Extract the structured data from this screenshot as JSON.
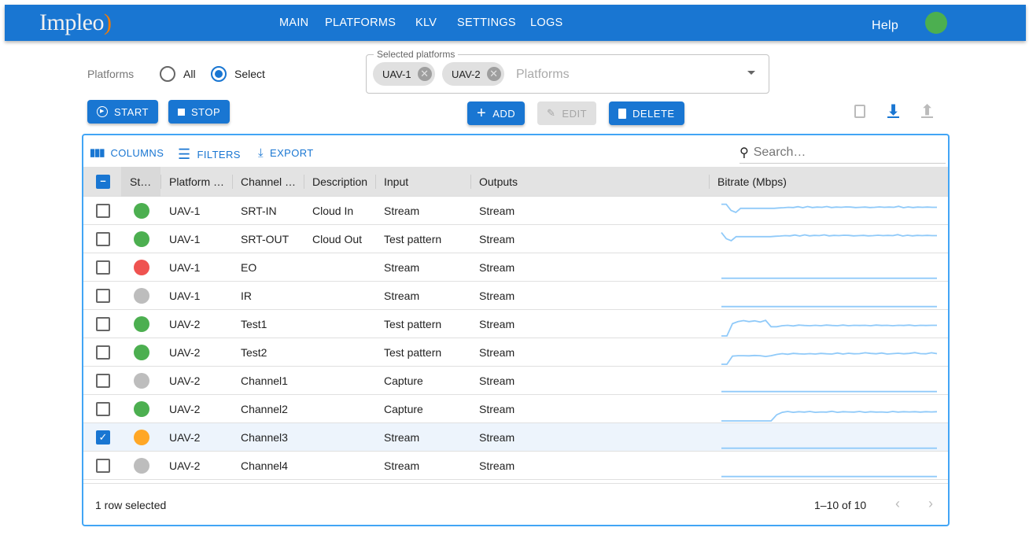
{
  "colors": {
    "primary": "#1976d2",
    "green": "#4caf50",
    "red": "#ef5350",
    "grey": "#bdbdbd",
    "orange": "#ffa726",
    "sparkline": "#90caf9"
  },
  "nav": {
    "logo": "Impleo",
    "items": [
      "MAIN",
      "PLATFORMS",
      "KLV",
      "SETTINGS",
      "LOGS"
    ],
    "help": "Help"
  },
  "filter": {
    "label": "Platforms",
    "options": [
      "All",
      "Select"
    ],
    "selected": "Select",
    "legend": "Selected platforms",
    "chips": [
      "UAV-1",
      "UAV-2"
    ],
    "placeholder": "Platforms"
  },
  "actions": {
    "start": "START",
    "stop": "STOP",
    "add": "ADD",
    "edit": "EDIT",
    "delete": "DELETE"
  },
  "toolbar": {
    "columns": "COLUMNS",
    "filters": "FILTERS",
    "export": "EXPORT",
    "search_placeholder": "Search…"
  },
  "columns": [
    "St…",
    "Platform …",
    "Channel …",
    "Description",
    "Input",
    "Outputs",
    "Bitrate (Mbps)"
  ],
  "rows": [
    {
      "status": "green",
      "platform": "UAV-1",
      "channel": "SRT-IN",
      "description": "Cloud In",
      "input": "Stream",
      "outputs": "Stream",
      "checked": false,
      "bitrate": [
        9,
        9,
        6,
        5,
        7,
        7,
        7,
        7,
        7,
        7,
        7,
        7,
        7.2,
        7.3,
        7.5,
        7.4,
        7.8,
        7.3,
        7.9,
        7.4,
        7.6,
        7.5,
        7.9,
        7.4,
        7.6,
        7.5,
        7.7,
        7.6,
        7.4,
        7.5,
        7.6,
        7.4,
        7.5,
        7.7,
        7.5,
        7.6,
        7.5,
        8,
        7.3,
        7.7,
        7.4,
        7.6,
        7.5,
        7.6,
        7.5,
        7.5
      ]
    },
    {
      "status": "green",
      "platform": "UAV-1",
      "channel": "SRT-OUT",
      "description": "Cloud Out",
      "input": "Test pattern",
      "outputs": "Stream",
      "checked": false,
      "bitrate": [
        9,
        6,
        5,
        7,
        7,
        7,
        7,
        7,
        7,
        7,
        7,
        7.2,
        7.3,
        7.5,
        7.4,
        7.8,
        7.3,
        7.9,
        7.4,
        7.6,
        7.5,
        7.9,
        7.4,
        7.6,
        7.5,
        7.7,
        7.6,
        7.4,
        7.5,
        7.6,
        7.4,
        7.5,
        7.7,
        7.5,
        7.6,
        7.5,
        8,
        7.3,
        7.7,
        7.4,
        7.6,
        7.5,
        7.6,
        7.5,
        7.5
      ]
    },
    {
      "status": "red",
      "platform": "UAV-1",
      "channel": "EO",
      "description": "",
      "input": "Stream",
      "outputs": "Stream",
      "checked": false,
      "bitrate": [
        0.5,
        0.5,
        0.5,
        0.5,
        0.5,
        0.5
      ]
    },
    {
      "status": "grey",
      "platform": "UAV-1",
      "channel": "IR",
      "description": "",
      "input": "Stream",
      "outputs": "Stream",
      "checked": false,
      "bitrate": [
        0.5,
        0.5,
        0.5,
        0.5,
        0.5,
        0.5
      ]
    },
    {
      "status": "green",
      "platform": "UAV-2",
      "channel": "Test1",
      "description": "",
      "input": "Test pattern",
      "outputs": "Stream",
      "checked": false,
      "bitrate": [
        0,
        0,
        6,
        7,
        7.5,
        7,
        7.4,
        6.8,
        7.6,
        4.5,
        4.5,
        5,
        5.2,
        4.9,
        5.3,
        5.1,
        5,
        5.2,
        5,
        5.3,
        5.1,
        5,
        5.3,
        5,
        5.2,
        5.1,
        5.2,
        5,
        5.3,
        5.1,
        5.2,
        5,
        5.2,
        5.1,
        5.3,
        5,
        5.2,
        5.1,
        5.2,
        5.2
      ]
    },
    {
      "status": "green",
      "platform": "UAV-2",
      "channel": "Test2",
      "description": "",
      "input": "Test pattern",
      "outputs": "Stream",
      "checked": false,
      "bitrate": [
        0,
        0,
        4,
        4.2,
        4.2,
        4.1,
        4.3,
        4.2,
        3.8,
        4.2,
        4.8,
        5.2,
        4.9,
        5.3,
        5.1,
        5,
        5.2,
        5,
        5.3,
        5.1,
        5,
        5.5,
        5,
        5.4,
        5.1,
        5.2,
        5.6,
        5.3,
        5.1,
        5.5,
        5,
        5.2,
        5.4,
        5.1,
        5.3,
        5.7,
        5.2,
        5.1,
        5.6,
        5.2
      ]
    },
    {
      "status": "grey",
      "platform": "UAV-2",
      "channel": "Channel1",
      "description": "",
      "input": "Capture",
      "outputs": "Stream",
      "checked": false,
      "bitrate": [
        0.5,
        0.5,
        0.5,
        0.5,
        0.5,
        0.5
      ]
    },
    {
      "status": "green",
      "platform": "UAV-2",
      "channel": "Channel2",
      "description": "",
      "input": "Capture",
      "outputs": "Stream",
      "checked": false,
      "bitrate": [
        0,
        0,
        0,
        0,
        0,
        0,
        0,
        0,
        0,
        0,
        3,
        4.2,
        4.6,
        4.2,
        4.5,
        4.3,
        4.6,
        4.2,
        4.4,
        4.3,
        4.7,
        4.2,
        4.5,
        4.4,
        4.3,
        4.6,
        4.2,
        4.5,
        4.3,
        4.4,
        4.2,
        4.6,
        4.3,
        4.5,
        4.4,
        4.5,
        4.3,
        4.5,
        4.4,
        4.5
      ]
    },
    {
      "status": "orange",
      "platform": "UAV-2",
      "channel": "Channel3",
      "description": "",
      "input": "Stream",
      "outputs": "Stream",
      "checked": true,
      "bitrate": [
        0.5,
        0.5,
        0.5,
        0.5,
        0.5,
        0.5
      ]
    },
    {
      "status": "grey",
      "platform": "UAV-2",
      "channel": "Channel4",
      "description": "",
      "input": "Stream",
      "outputs": "Stream",
      "checked": false,
      "bitrate": [
        0.5,
        0.5,
        0.5,
        0.5,
        0.5,
        0.5
      ]
    }
  ],
  "footer": {
    "selected": "1 row selected",
    "range": "1–10 of 10"
  }
}
